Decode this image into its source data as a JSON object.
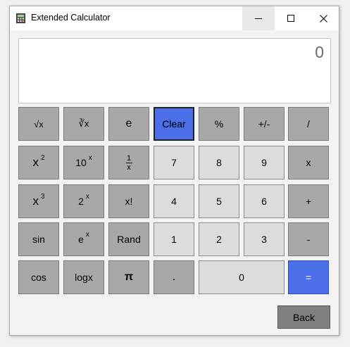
{
  "window": {
    "title": "Extended Calculator"
  },
  "display": {
    "value": "0"
  },
  "keys": {
    "sqrt": "√x",
    "cbrt": "∛x",
    "e": "e",
    "clear": "Clear",
    "percent": "%",
    "plus_minus": "+/-",
    "divide": "/",
    "square_base": "x",
    "square_exp": "2",
    "pow10_base": "10",
    "pow10_exp": "x",
    "recip_num": "1",
    "recip_den": "x",
    "seven": "7",
    "eight": "8",
    "nine": "9",
    "multiply": "x",
    "cube_base": "x",
    "cube_exp": "3",
    "pow2_base": "2",
    "pow2_exp": "x",
    "factorial": "x!",
    "four": "4",
    "five": "5",
    "six": "6",
    "plus": "+",
    "sin": "sin",
    "exp_base": "e",
    "exp_exp": "x",
    "rand": "Rand",
    "one": "1",
    "two": "2",
    "three": "3",
    "minus": "-",
    "cos": "cos",
    "log": "logx",
    "pi": "π",
    "dot": ".",
    "zero": "0",
    "equals": "=",
    "back": "Back"
  },
  "colors": {
    "accent": "#4a6fe8",
    "key_dark": "#a8a8a8",
    "key_light": "#dcdcdc",
    "back": "#808080"
  }
}
